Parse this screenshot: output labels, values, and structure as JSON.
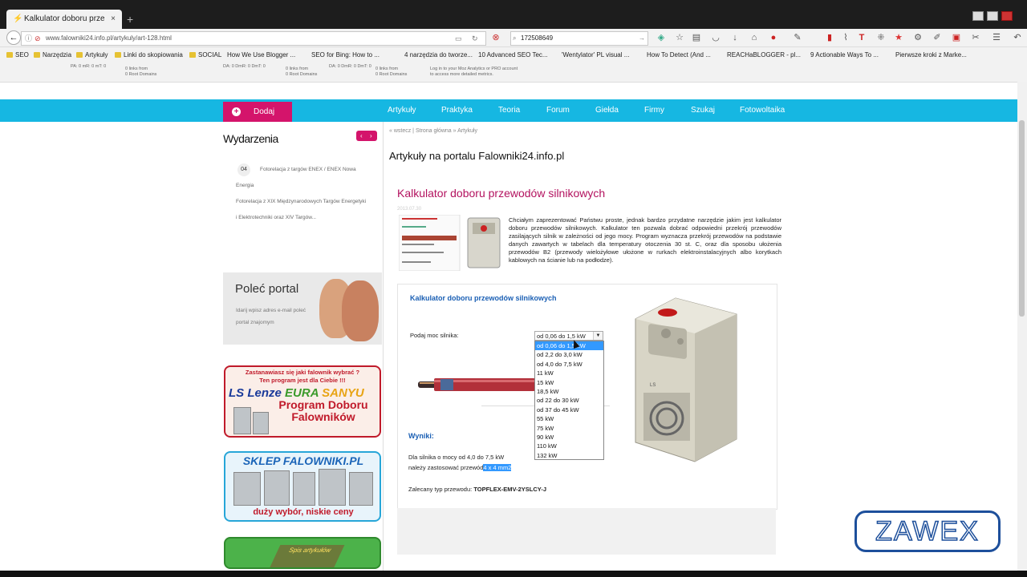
{
  "browser": {
    "tab_title": "Kalkulator doboru przewod...",
    "tab_close": "×",
    "new_tab": "+",
    "url": "www.falowniki24.info.pl/artykuly/art-128.html",
    "search_value": "172508649"
  },
  "bookmarks": [
    "SEO",
    "Narzędzia",
    "Artykuły",
    "Linki do skopiowania",
    "SOCIAL",
    "How We Use Blogger ...",
    "SEO for Bing: How to ...",
    "4 narzędzia do tworze...",
    "10 Advanced SEO Tec...",
    "'Wentylator' PL visual ...",
    "How To Detect (And ...",
    "REACHaBLOGGER - pl...",
    "9 Actionable Ways To ...",
    "Pierwsze kroki z Marke..."
  ],
  "mozbar": {
    "m1": "PA: 0    mR: 0    mT: 0",
    "m2": "0 links from",
    "m3": "0 Root Domains",
    "m4": "DA: 0    DmR: 0    DmT: 0",
    "m5": "0 links from",
    "m6": "0 Root Domains",
    "m7": "DA: 0    DmR: 0    DmT: 0",
    "m8": "0 links from",
    "m9": "0 Root Domains",
    "m10": "Log in to your Moz Analytics or PRO account",
    "m11": "to access more detailed metrics."
  },
  "nav": {
    "add_label": "Dodaj",
    "items": [
      "Artykuły",
      "Praktyka",
      "Teoria",
      "Forum",
      "Giełda",
      "Firmy",
      "Szukaj",
      "Fotowoltaika"
    ]
  },
  "sidebar": {
    "events_title": "Wydarzenia",
    "event_day": "04",
    "event1_line1": "Fotorelacja z targów ENEX / ENEX Nowa",
    "event1_line2": "Energia",
    "event2_line1": "Fotorelacja z XIX Międzynarodowych Targów Energetyki",
    "event2_line2": "i Elektrotechniki oraz XIV Targów...",
    "polec_title": "Poleć portal",
    "polec_sub": "Idarij wpisz adres e-mail poleć portal znajomym",
    "ad1_line1": "Zastanawiasz się jaki falownik wybrać ?",
    "ad1_line2": "Ten program jest dla Ciebie !!!",
    "ad1_brand_ls": "LS",
    "ad1_brand_lenze": "Lenze",
    "ad1_brand_eura": "EURA",
    "ad1_brand_sanyu": "SANYU",
    "ad1_prog": "Program Doboru Falowników",
    "ad2_line1": "SKLEP FALOWNIKI.PL",
    "ad2_line2": "duży wybór, niskie ceny",
    "ad3_label": "Spis artykułów"
  },
  "main": {
    "breadcrumb": "« wstecz | Strona główna » Artykuły",
    "heading": "Artykuły na portalu Falowniki24.info.pl",
    "article_title": "Kalkulator doboru przewodów silnikowych",
    "article_date": "2013.07.30",
    "article_text": "Chciałym zaprezentować Państwu proste, jednak bardzo przydatne narzędzie jakim jest kalkulator doboru przewodów silnikowych. Kalkulator ten pozwala dobrać odpowiedni przekrój przewodów zasilających silnik w zależności od jego mocy. Program wyznacza przekrój przewodów na podstawie danych zawartych w tabelach dla temperatury otoczenia 30 st. C, oraz dla sposobu ułożenia przewodów B2 (przewody wielożyłowe ułożone w rurkach elektroinstalacyjnych albo korytkach kablowych na ścianie lub na podłodze)."
  },
  "calculator": {
    "title": "Kalkulator doboru przewodów silnikowych",
    "power_label": "Podaj moc silnika:",
    "selected": "od 0,06 do 1,5 kW",
    "options": [
      "od 0,06 do 1,5 kW",
      "od 2,2 do 3,0 kW",
      "od 4,0 do 7,5 kW",
      "11 kW",
      "15 kW",
      "18,5 kW",
      "od 22 do 30 kW",
      "od 37 do 45 kW",
      "55 kW",
      "75 kW",
      "90 kW",
      "110 kW",
      "132 kW"
    ],
    "highlighted_index": 0,
    "results_label": "Wyniki:",
    "result_line1": "Dla silnika o mocy od 4,0 do 7,5 kW",
    "result_line2_prefix": "należy zastosować przewód",
    "result_line2_value": "4 x 4 mm2",
    "result_line3_prefix": "Zalecany typ przewodu:",
    "result_line3_value": "TOPFLEX-EMV-2YSLCY-J"
  },
  "watermark": "ZAWEX",
  "colors": {
    "accent_cyan": "#16b7e2",
    "accent_magenta": "#d4146b",
    "link_blue": "#1a5fb4"
  }
}
